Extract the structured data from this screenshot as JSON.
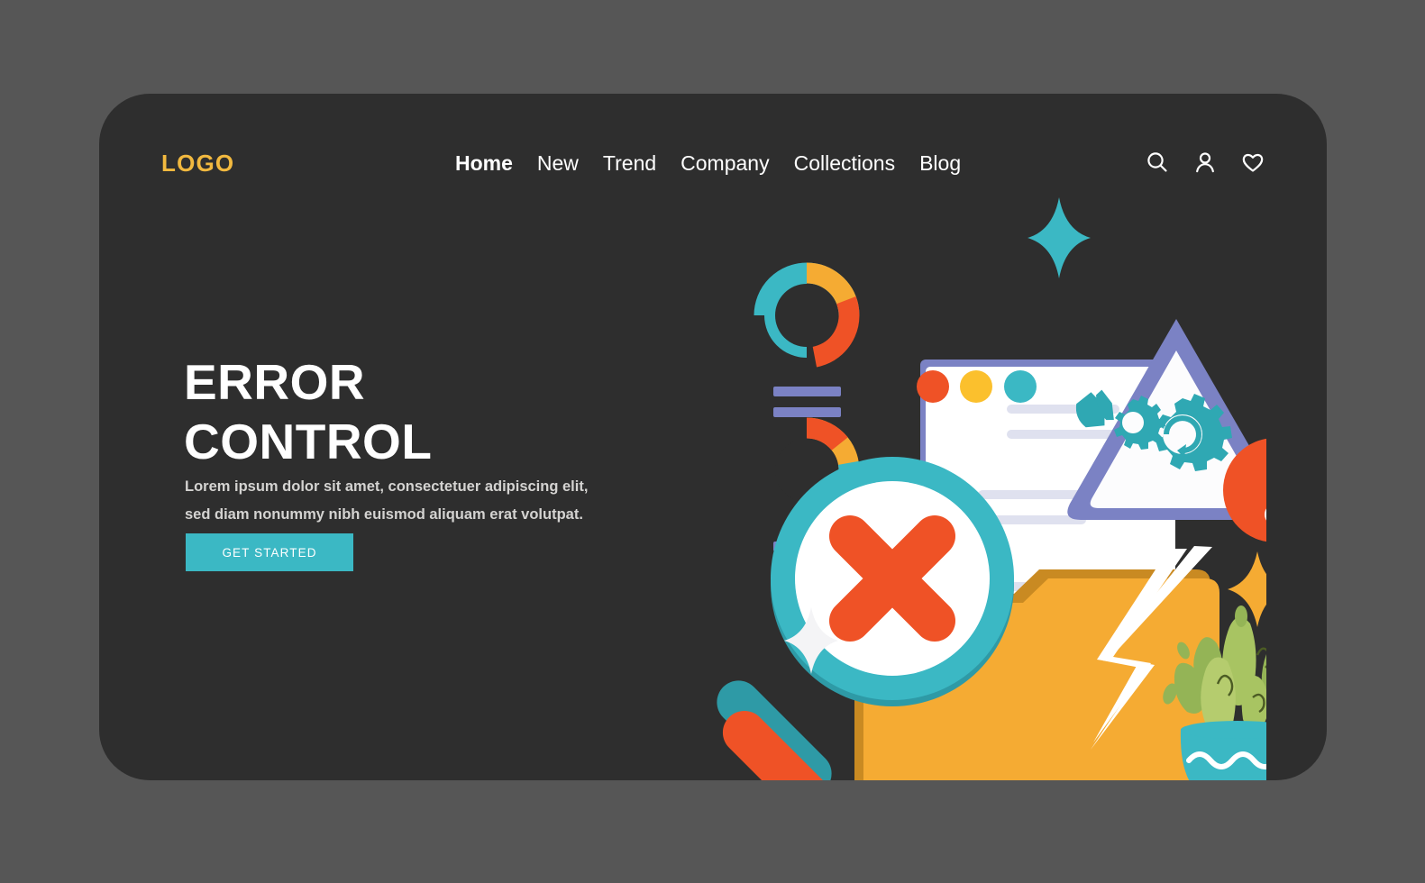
{
  "page": {
    "background_color": "#565656",
    "card_color": "#2e2e2e"
  },
  "header": {
    "logo": "LOGO",
    "logo_color": "#f2b93f",
    "nav": [
      {
        "label": "Home",
        "active": true
      },
      {
        "label": "New",
        "active": false
      },
      {
        "label": "Trend",
        "active": false
      },
      {
        "label": "Company",
        "active": false
      },
      {
        "label": "Collections",
        "active": false
      },
      {
        "label": "Blog",
        "active": false
      }
    ],
    "icons": [
      {
        "name": "search-icon"
      },
      {
        "name": "user-icon"
      },
      {
        "name": "heart-icon"
      }
    ]
  },
  "hero": {
    "title_line1": "ERROR",
    "title_line2": "CONTROL",
    "body": "Lorem ipsum dolor sit amet, consectetuer adipiscing elit, sed diam nonummy nibh euismod aliquam erat volutpat.",
    "cta_label": "GET STARTED",
    "cta_color": "#3bb8c4"
  },
  "illustration": {
    "name": "error-control-illustration",
    "elements": [
      "donut-chart-top",
      "donut-chart-bottom",
      "bar-lines",
      "document-card",
      "warning-triangle",
      "gear-icons",
      "exclamation-badge",
      "magnifier-with-x",
      "folder",
      "lightning-bolt",
      "cactus-plant",
      "sparkle-teal",
      "sparkle-white",
      "sparkle-yellow"
    ],
    "palette": {
      "teal": "#3bb8c4",
      "teal_dark": "#2e9aa6",
      "orange": "#ef5226",
      "amber": "#f5ab33",
      "yellow": "#fbc02d",
      "purple": "#7b82c4",
      "lavender": "#e2e3f0",
      "white": "#ffffff",
      "green": "#a8c martha"
    }
  }
}
